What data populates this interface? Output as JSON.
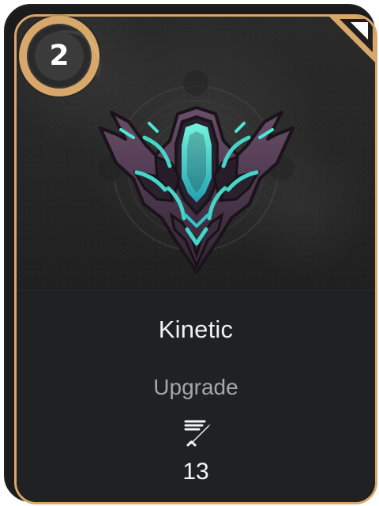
{
  "card": {
    "level": "2",
    "title": "Kinetic",
    "type": "Upgrade",
    "stat_value": "13",
    "stat_icon": "sword-icon",
    "corner_icon": "corner-tab-icon",
    "emblem_icon": "guild-crest-icon",
    "accent_color": "#d8a86b",
    "emblem_glow_color": "#43d8c7"
  }
}
